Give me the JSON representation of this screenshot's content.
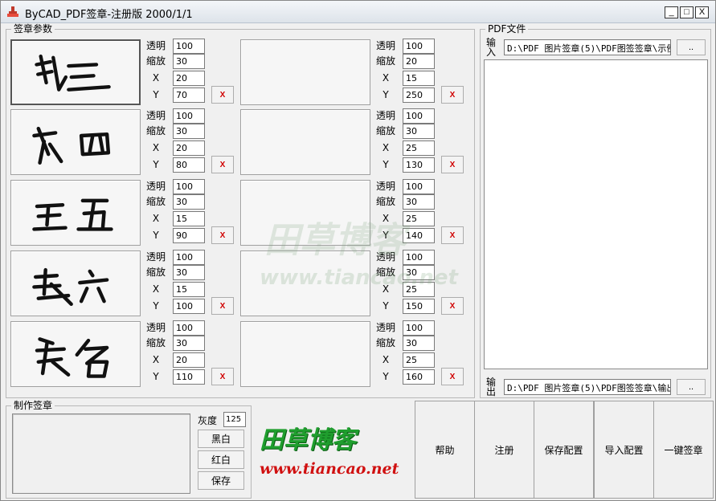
{
  "window": {
    "title": "ByCAD_PDF签章-注册版 2000/1/1",
    "minimize": "_",
    "maximize": "□",
    "close": "X"
  },
  "signature_group": {
    "label": "签章参数"
  },
  "param_labels": {
    "opacity": "透明",
    "scale": "缩放",
    "x": "X",
    "y": "Y"
  },
  "remove_label": "X",
  "rows": [
    {
      "left": {
        "name": "张三",
        "opacity": "100",
        "scale": "30",
        "x": "20",
        "y": "70"
      },
      "right": {
        "name": "",
        "opacity": "100",
        "scale": "20",
        "x": "15",
        "y": "250"
      }
    },
    {
      "left": {
        "name": "李四",
        "opacity": "100",
        "scale": "30",
        "x": "20",
        "y": "80"
      },
      "right": {
        "name": "",
        "opacity": "100",
        "scale": "30",
        "x": "25",
        "y": "130"
      }
    },
    {
      "left": {
        "name": "王五",
        "opacity": "100",
        "scale": "30",
        "x": "15",
        "y": "90"
      },
      "right": {
        "name": "",
        "opacity": "100",
        "scale": "30",
        "x": "25",
        "y": "140"
      }
    },
    {
      "left": {
        "name": "赵六",
        "opacity": "100",
        "scale": "30",
        "x": "15",
        "y": "100"
      },
      "right": {
        "name": "",
        "opacity": "100",
        "scale": "30",
        "x": "25",
        "y": "150"
      }
    },
    {
      "left": {
        "name": "签名",
        "opacity": "100",
        "scale": "30",
        "x": "20",
        "y": "110"
      },
      "right": {
        "name": "",
        "opacity": "100",
        "scale": "30",
        "x": "25",
        "y": "160"
      }
    }
  ],
  "pdf_group": {
    "label": "PDF文件",
    "input_label": "输入",
    "input_path": "D:\\PDF 图片签章(5)\\PDF图签签章\\示例",
    "output_label": "输出",
    "output_path": "D:\\PDF 图片签章(5)\\PDF图签签章\\输出",
    "browse_label": ".."
  },
  "make_group": {
    "label": "制作签章",
    "gray_label": "灰度",
    "gray_value": "125",
    "bw_label": "黑白",
    "red_label": "红白",
    "save_label": "保存"
  },
  "logo": {
    "cn": "田草博客",
    "url": "www.tiancao.net",
    "color": "#1f9e2e"
  },
  "watermark": {
    "cn": "田草博客",
    "url": "www.tiancao.net"
  },
  "actions": {
    "help": "帮助",
    "register": "注册",
    "save_config": "保存配置",
    "import_config": "导入配置",
    "one_click": "一键签章"
  },
  "colors": {
    "remove_button": "#d00000",
    "window_bg": "#f0f0f0"
  },
  "icons": {
    "app": "stamp-icon"
  }
}
